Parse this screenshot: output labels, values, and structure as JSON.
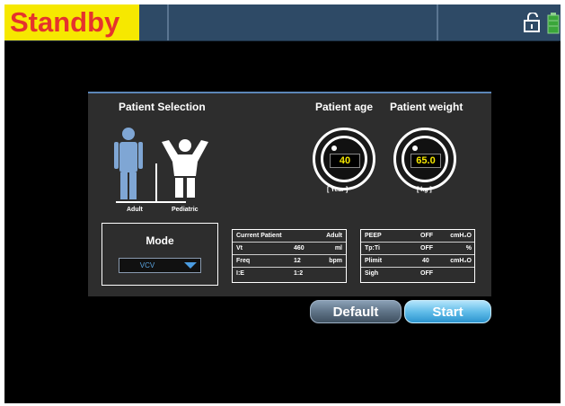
{
  "status": {
    "mode_label": "Standby",
    "colors": {
      "banner_bg": "#f6e800",
      "banner_text": "#e5322d",
      "bar_bg": "#2e4a66"
    },
    "icons": [
      "lock-open-icon",
      "battery-icon"
    ]
  },
  "patient_selection": {
    "title": "Patient Selection",
    "adult_label": "Adult",
    "pediatric_label": "Pediatric",
    "icons": [
      "adult-figure-icon",
      "pediatric-figure-icon"
    ]
  },
  "patient_age": {
    "title": "Patient age",
    "value": "40",
    "unit": "[ Year ]"
  },
  "patient_weight": {
    "title": "Patient weight",
    "value": "65.0",
    "unit": "[ kg ]"
  },
  "mode": {
    "title": "Mode",
    "selected": "VCV"
  },
  "current_patient_table": {
    "rows": [
      {
        "label": "Current Patient",
        "value": "Adult",
        "unit": ""
      },
      {
        "label": "Vt",
        "value": "460",
        "unit": "ml"
      },
      {
        "label": "Freq",
        "value": "12",
        "unit": "bpm"
      },
      {
        "label": "I:E",
        "value": "1:2",
        "unit": ""
      }
    ]
  },
  "settings_table": {
    "rows": [
      {
        "label": "PEEP",
        "value": "OFF",
        "unit": "cmH₂O"
      },
      {
        "label": "Tp:Ti",
        "value": "OFF",
        "unit": "%"
      },
      {
        "label": "Plimit",
        "value": "40",
        "unit": "cmH₂O"
      },
      {
        "label": "Sigh",
        "value": "OFF",
        "unit": ""
      }
    ]
  },
  "buttons": {
    "default_label": "Default",
    "start_label": "Start"
  }
}
